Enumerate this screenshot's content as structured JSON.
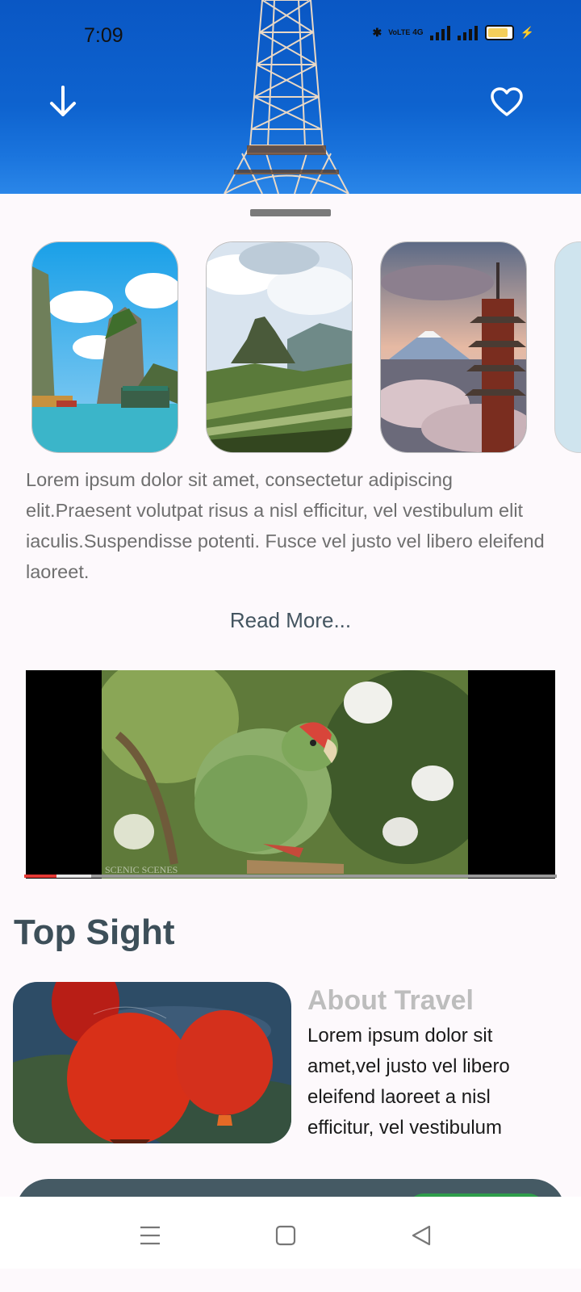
{
  "status_bar": {
    "time": "7:09",
    "signal_labels": [
      "VoLTE",
      "4G"
    ]
  },
  "hero": {
    "download_icon": "download-arrow-icon",
    "favorite_icon": "heart-outline-icon"
  },
  "destinations": [
    "halong-bay-photo",
    "machu-picchu-photo",
    "mount-fuji-pagoda-photo"
  ],
  "description": "Lorem ipsum dolor sit amet, consectetur adipiscing elit.Praesent volutpat risus a nisl efficitur, vel vestibulum elit iaculis.Suspendisse potenti. Fusce vel justo vel libero eleifend laoreet.",
  "read_more": "Read More...",
  "video": {
    "watermark": "SCENIC SCENES",
    "progress": 0.06,
    "buffered": 0.125
  },
  "top_sight": {
    "heading": "Top Sight",
    "card_title": "About Travel",
    "card_text": "Lorem ipsum dolor sit amet,vel justo vel libero eleifend laoreet  a nisl efficitur, vel vestibulum"
  },
  "colors": {
    "hero_blue": "#0e63cf",
    "heading": "#3d4f59",
    "bar": "#455a64",
    "accent_green": "#2e9d4a",
    "progress_red": "#e53935"
  },
  "nav_icons": [
    "menu-icon",
    "home-square-icon",
    "back-triangle-icon"
  ]
}
